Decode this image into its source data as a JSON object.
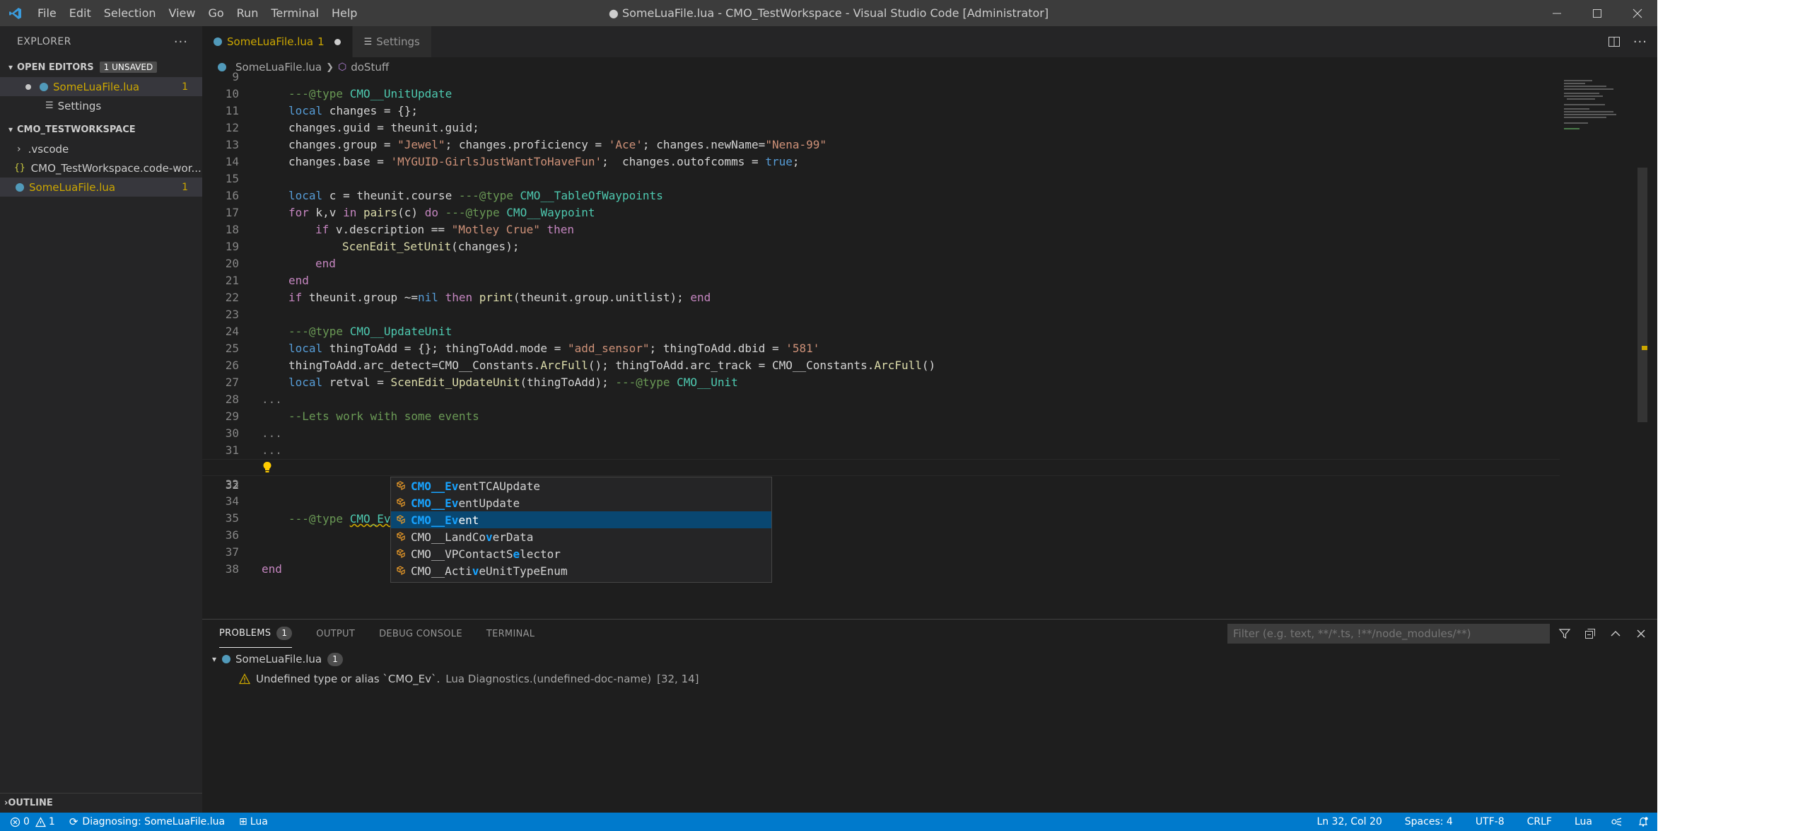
{
  "window": {
    "title": "● SomeLuaFile.lua - CMO_TestWorkspace - Visual Studio Code [Administrator]",
    "menu": [
      "File",
      "Edit",
      "Selection",
      "View",
      "Go",
      "Run",
      "Terminal",
      "Help"
    ]
  },
  "sidebar": {
    "title": "EXPLORER",
    "open_editors": {
      "label": "OPEN EDITORS",
      "badge": "1 UNSAVED",
      "items": [
        {
          "label": "SomeLuaFile.lua",
          "count": "1"
        },
        {
          "label": "Settings"
        }
      ]
    },
    "workspace": {
      "label": "CMO_TESTWORKSPACE",
      "items": [
        {
          "label": ".vscode"
        },
        {
          "label": "CMO_TestWorkspace.code-wor..."
        },
        {
          "label": "SomeLuaFile.lua",
          "count": "1"
        }
      ]
    },
    "outline_label": "OUTLINE"
  },
  "editor": {
    "tabs": [
      {
        "label": "SomeLuaFile.lua",
        "count": "1"
      },
      {
        "label": "Settings"
      }
    ],
    "breadcrumb": [
      "SomeLuaFile.lua",
      "doStuff"
    ],
    "line_numbers": [
      "9",
      "10",
      "11",
      "12",
      "13",
      "14",
      "15",
      "16",
      "17",
      "18",
      "19",
      "20",
      "21",
      "22",
      "23",
      "24",
      "25",
      "26",
      "27",
      "28",
      "29",
      "30",
      "31",
      "32",
      "33",
      "34",
      "35",
      "36",
      "37",
      "38"
    ],
    "code": {
      "l10a": "---@type ",
      "l10b": "CMO__UnitUpdate",
      "l11a": "local",
      "l11b": " changes = {};",
      "l12": "changes.guid = theunit.guid;",
      "l13a": "changes.group = ",
      "l13b": "\"Jewel\"",
      "l13c": "; changes.proficiency = ",
      "l13d": "'Ace'",
      "l13e": "; changes.newName=",
      "l13f": "\"Nena-99\"",
      "l14a": "changes.base = ",
      "l14b": "'MYGUID-GirlsJustWantToHaveFun'",
      "l14c": ";  changes.outofcomms = ",
      "l14d": "true",
      "l14e": ";",
      "l16a": "local",
      "l16b": " c = theunit.course ",
      "l16c": "---@type ",
      "l16d": "CMO__TableOfWaypoints",
      "l17a": "for",
      "l17b": " k,v ",
      "l17c": "in",
      "l17d": " ",
      "l17e": "pairs",
      "l17f": "(c) ",
      "l17g": "do",
      "l17h": " ",
      "l17i": "---@type ",
      "l17j": "CMO__Waypoint",
      "l18a": "if",
      "l18b": " v.description == ",
      "l18c": "\"Motley Crue\"",
      "l18d": " ",
      "l18e": "then",
      "l19a": "ScenEdit_SetUnit",
      "l19b": "(changes);",
      "l20": "end",
      "l21": "end",
      "l22a": "if",
      "l22b": " theunit.group ~=",
      "l22c": "nil",
      "l22d": " ",
      "l22e": "then",
      "l22f": " ",
      "l22g": "print",
      "l22h": "(theunit.group.unitlist); ",
      "l22i": "end",
      "l24a": "---@type ",
      "l24b": "CMO__UpdateUnit",
      "l25a": "local",
      "l25b": " thingToAdd = {}; thingToAdd.mode = ",
      "l25c": "\"add_sensor\"",
      "l25d": "; thingToAdd.dbid = ",
      "l25e": "'581'",
      "l26a": "thingToAdd.arc_detect=CMO__Constants.",
      "l26b": "ArcFull",
      "l26c": "(); thingToAdd.arc_track = CMO__Constants.",
      "l26d": "ArcFull",
      "l26e": "()",
      "l27a": "local",
      "l27b": " retval = ",
      "l27c": "ScenEdit_UpdateUnit",
      "l27d": "(thingToAdd); ",
      "l27e": "---@type ",
      "l27f": "CMO__Unit",
      "l28": "...",
      "l29": "--Lets work with some events",
      "l30": "...",
      "l31": "...",
      "l32a": "---@type ",
      "l32b": "CMO_Ev",
      "l38": "end"
    },
    "suggestions": [
      {
        "pre": "CMO__",
        "m": "Ev",
        "post": "entTCAUpdate"
      },
      {
        "pre": "CMO__",
        "m": "Ev",
        "post": "entUpdate"
      },
      {
        "pre": "CMO__",
        "m": "Ev",
        "post": "ent"
      },
      {
        "pre": "CMO__LandCo",
        "m": "v",
        "post": "erData"
      },
      {
        "pre": "CMO__VPContactS",
        "m": "e",
        "post": "lector"
      },
      {
        "pre": "CMO__Acti",
        "m": "v",
        "post": "eUnitTypeEnum"
      }
    ]
  },
  "panel": {
    "tabs": [
      {
        "label": "PROBLEMS",
        "count": "1"
      },
      {
        "label": "OUTPUT"
      },
      {
        "label": "DEBUG CONSOLE"
      },
      {
        "label": "TERMINAL"
      }
    ],
    "filter_placeholder": "Filter (e.g. text, **/*.ts, !**/node_modules/**)",
    "file": {
      "label": "SomeLuaFile.lua",
      "count": "1"
    },
    "problem": {
      "message": "Undefined type or alias `CMO_Ev`.",
      "source": "Lua Diagnostics.(undefined-doc-name)",
      "location": "[32, 14]"
    }
  },
  "status": {
    "errors": "0",
    "warnings": "1",
    "diagnosing": "Diagnosing: SomeLuaFile.lua",
    "lua_lib": "Lua",
    "position": "Ln 32, Col 20",
    "spaces": "Spaces: 4",
    "encoding": "UTF-8",
    "eol": "CRLF",
    "language": "Lua"
  },
  "colors": {
    "accent": "#007acc",
    "modified": "#cca700",
    "selection": "#094771"
  }
}
